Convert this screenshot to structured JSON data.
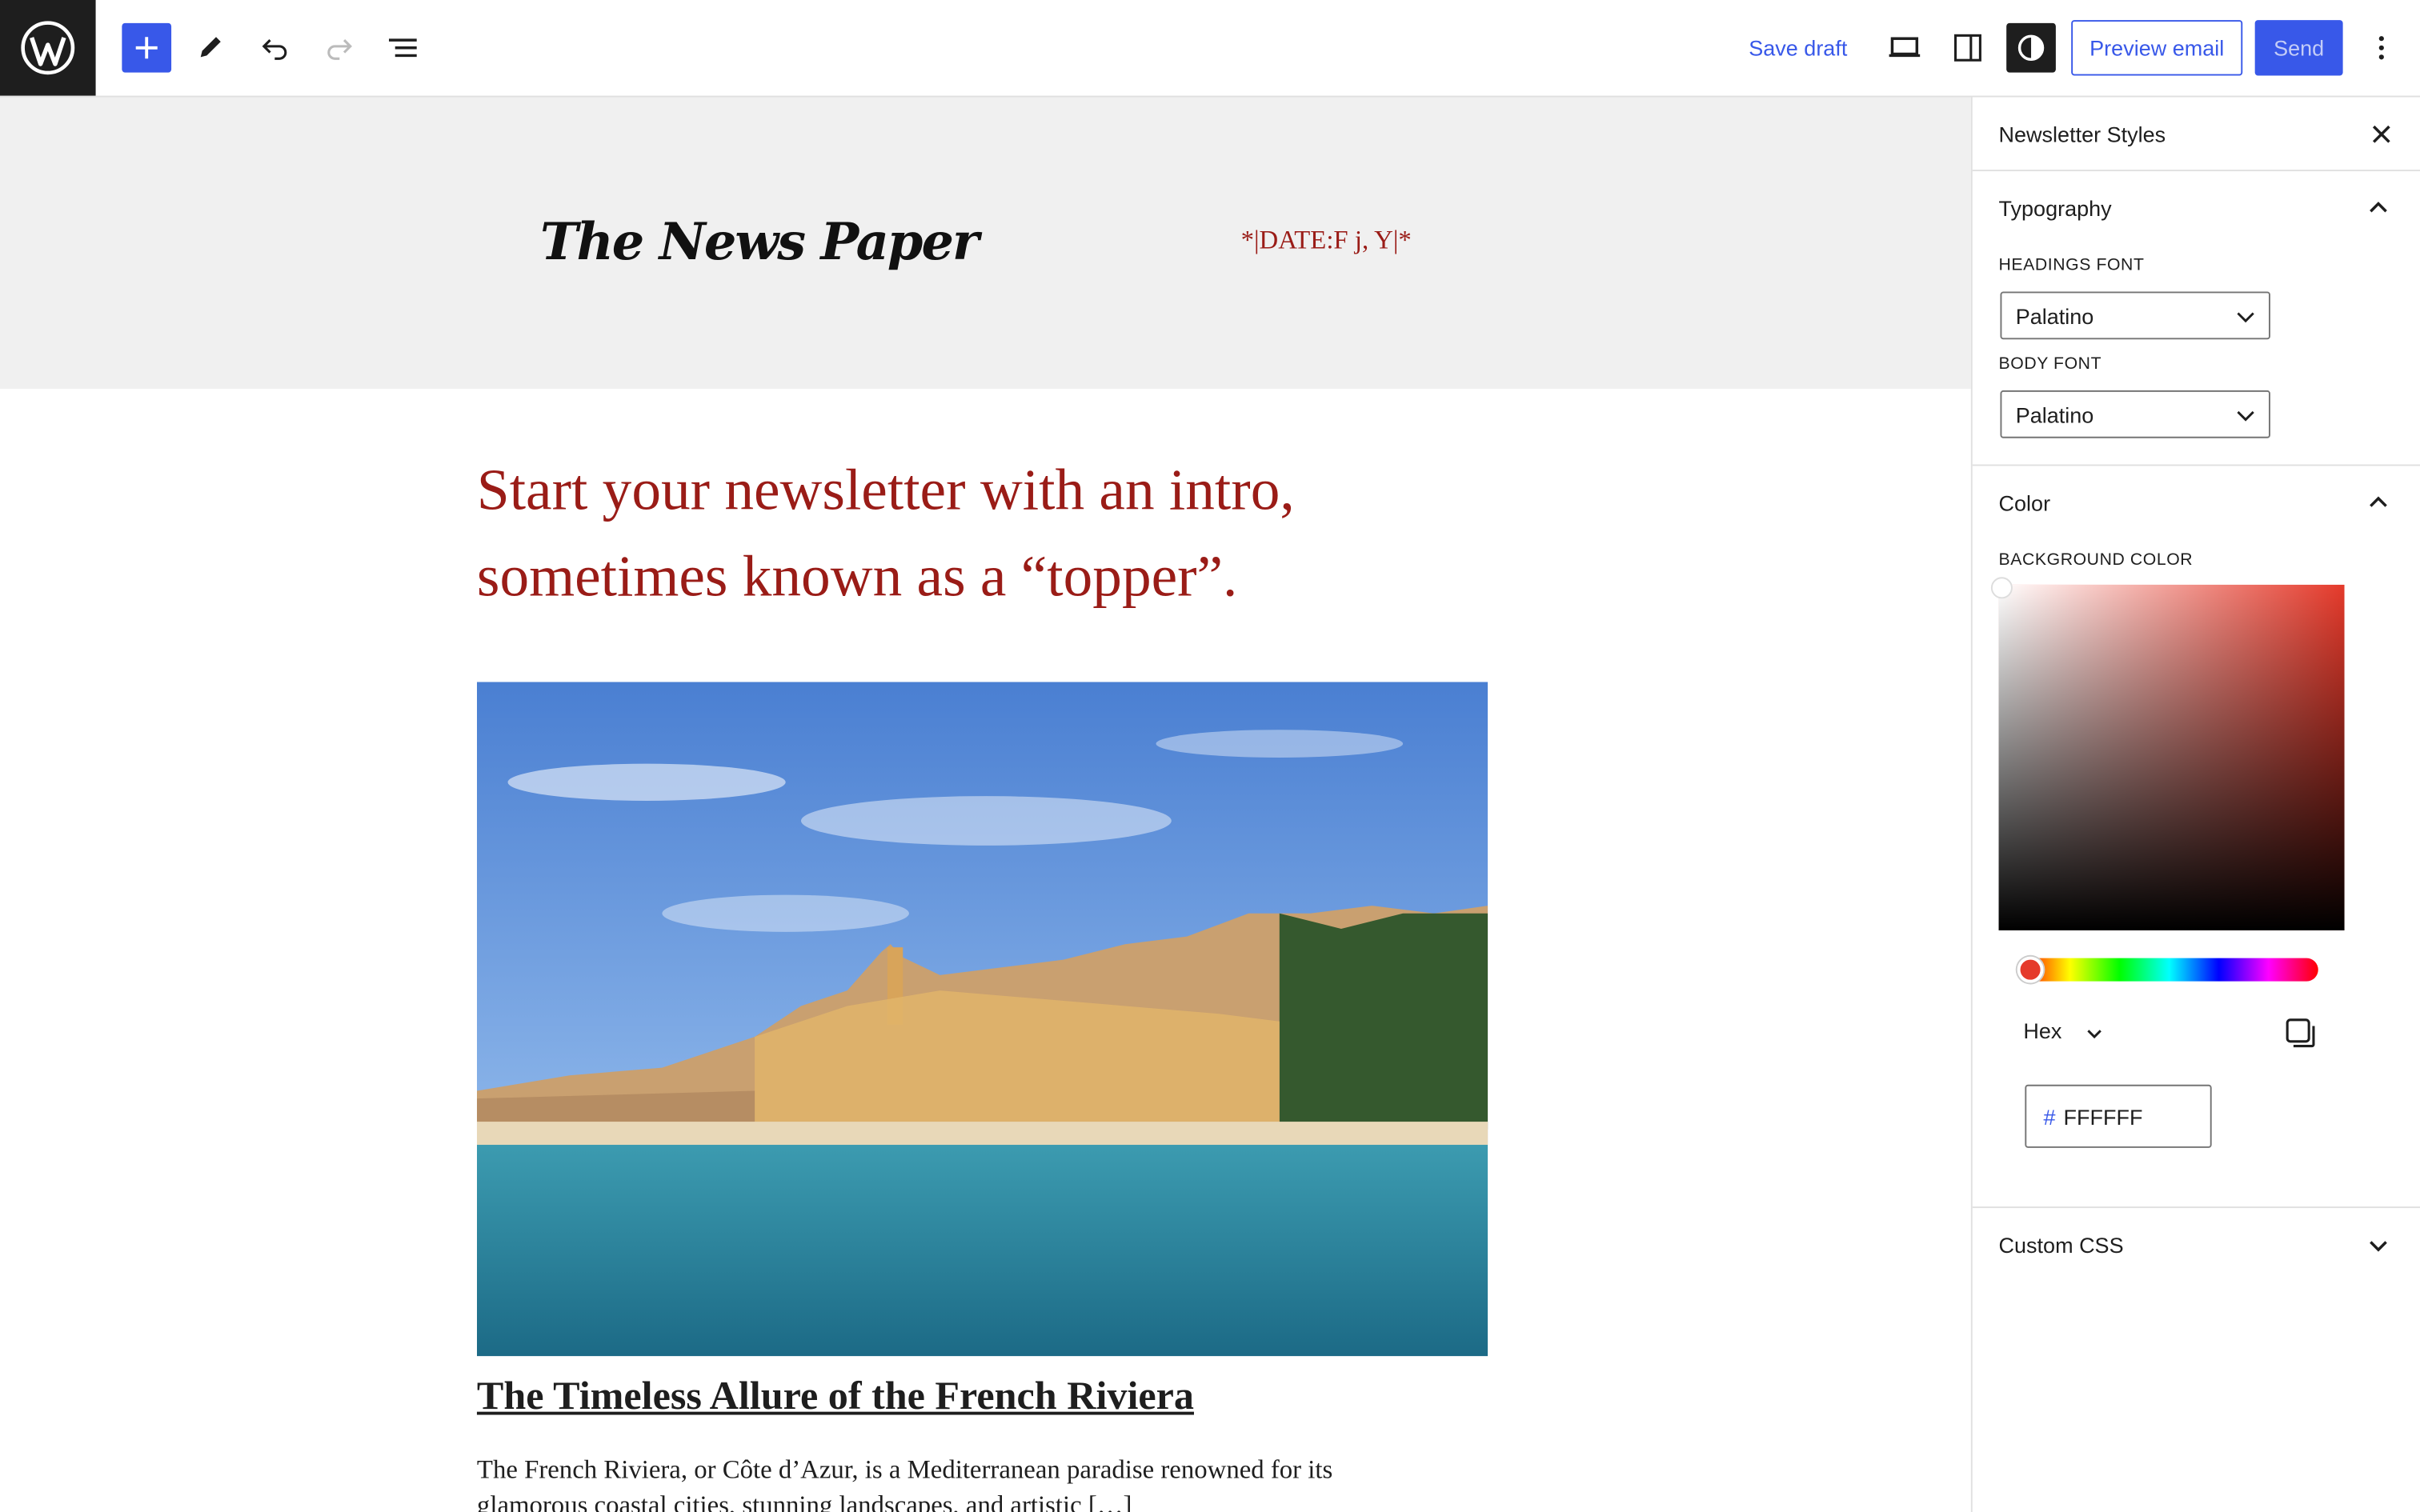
{
  "toolbar": {
    "save_draft": "Save draft",
    "preview_email": "Preview email",
    "send": "Send"
  },
  "canvas": {
    "masthead_logo": "The News Paper",
    "date_tag": "*|DATE:F j, Y|*",
    "intro": "Start your newsletter with an intro, sometimes known as a “topper”.",
    "post_title": "The Timeless Allure of the French Riviera",
    "post_body": "The French Riviera, or Côte d’Azur, is a Mediterranean paradise renowned for its glamorous coastal cities, stunning landscapes, and artistic […]"
  },
  "sidebar": {
    "title": "Newsletter Styles",
    "typography": {
      "label": "Typography",
      "headings_font_label": "HEADINGS FONT",
      "headings_font": "Palatino",
      "body_font_label": "BODY FONT",
      "body_font": "Palatino"
    },
    "color": {
      "label": "Color",
      "background_label": "BACKGROUND COLOR",
      "format": "Hex",
      "hash": "#",
      "hex_value": "FFFFFF"
    },
    "custom_css": {
      "label": "Custom CSS"
    }
  },
  "colors": {
    "accent": "#3858e9",
    "intro_text": "#9a1c17",
    "picker_hue": "#e53a2b"
  },
  "icons": [
    "wordpress-logo-icon",
    "plus-icon",
    "pencil-icon",
    "undo-icon",
    "redo-icon",
    "list-view-icon",
    "desktop-icon",
    "sidebar-icon",
    "contrast-icon",
    "more-vertical-icon",
    "close-icon",
    "chevron-up-icon",
    "chevron-down-icon",
    "copy-icon"
  ]
}
